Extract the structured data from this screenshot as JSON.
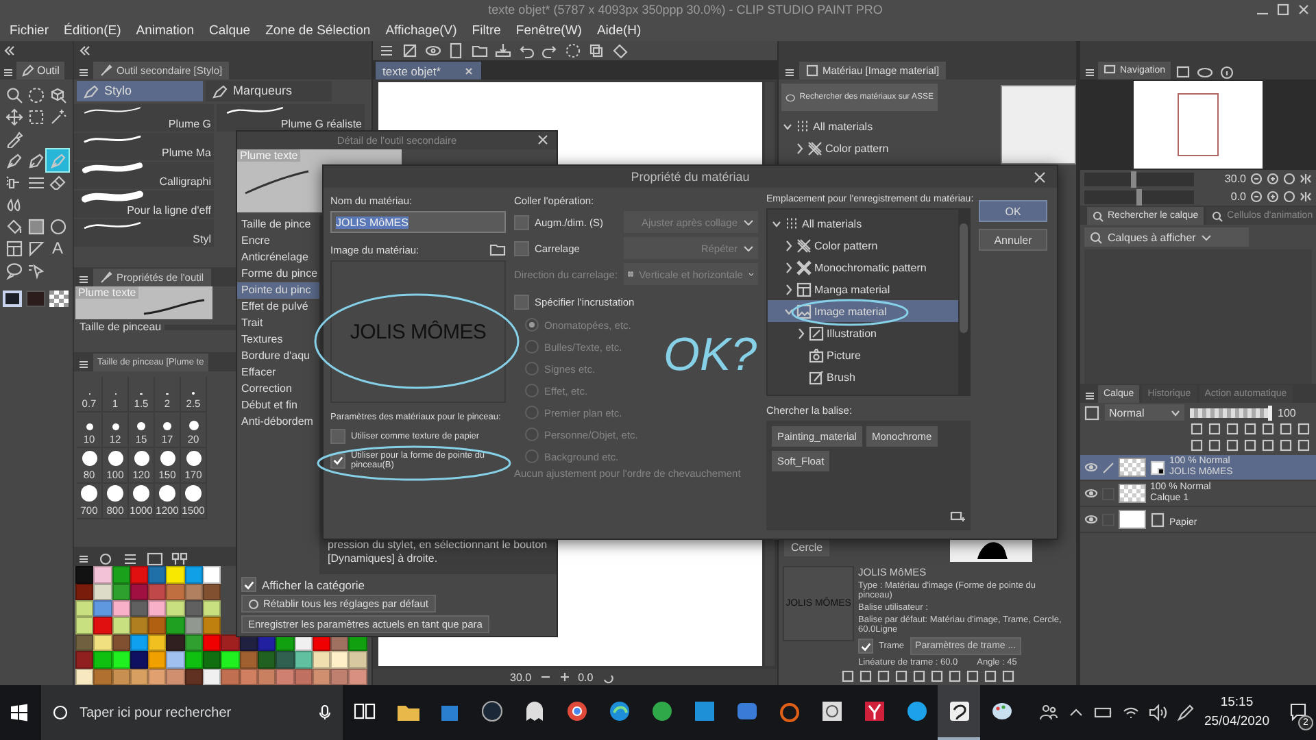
{
  "window": {
    "title": "texte objet* (5787 x 4093px 350ppp 30.0%) - CLIP STUDIO PAINT PRO"
  },
  "menu": [
    "Fichier",
    "Édition(E)",
    "Animation",
    "Calque",
    "Zone de Sélection",
    "Affichage(V)",
    "Filtre",
    "Fenêtre(W)",
    "Aide(H)"
  ],
  "tool_panel": {
    "tab": "Outil",
    "tools": [
      {
        "selected": false
      },
      {
        "selected": false
      },
      {
        "selected": false
      },
      {
        "selected": false
      },
      {
        "selected": false
      },
      {
        "selected": false
      },
      {
        "selected": false
      },
      {
        "selected": false
      },
      {
        "selected": false
      },
      {
        "selected": true
      },
      {
        "selected": false
      },
      {
        "selected": false
      },
      {
        "selected": false
      },
      {
        "selected": false
      },
      {
        "selected": false
      },
      {
        "selected": false
      },
      {
        "selected": false
      },
      {
        "selected": false
      },
      {
        "selected": false
      },
      {
        "selected": false,
        "label": "A"
      },
      {
        "selected": false
      },
      {
        "selected": false
      }
    ],
    "color_swatches": [
      {
        "color": "#1c2026",
        "selected": true
      },
      {
        "color": "#2c1c1c",
        "selected": false
      }
    ]
  },
  "subtool_panel": {
    "title": "Outil secondaire [Stylo]",
    "groups": [
      {
        "label": "Stylo",
        "selected": true
      },
      {
        "label": "Marqueurs",
        "selected": false
      }
    ],
    "brushes": [
      {
        "label": "Plume G",
        "selected": false
      },
      {
        "label": "Plume G réaliste",
        "selected": false
      },
      {
        "label": "Plume Ma",
        "selected": false
      },
      {
        "label": "Calligraphi",
        "selected": false
      },
      {
        "label": "Pour la ligne d'eff",
        "selected": false
      },
      {
        "label": "Styl",
        "selected": false
      }
    ]
  },
  "tool_properties": {
    "title": "Propriétés de l'outil",
    "preview_label": "Plume texte",
    "setting": "Taille de pinceau"
  },
  "brush_size": {
    "title": "Taille de pinceau [Plume te",
    "sizes": [
      "0.7",
      "1",
      "1.5",
      "2",
      "2.5",
      "10",
      "12",
      "15",
      "17",
      "20",
      "80",
      "100",
      "120",
      "150",
      "170",
      "700",
      "800",
      "1000",
      "1200",
      "1500"
    ]
  },
  "color_set": {
    "swatches": [
      {
        "color": "#121212"
      },
      {
        "color": "#f4c2d7"
      },
      {
        "color": "#1aa01a"
      },
      {
        "color": "#e01010"
      },
      {
        "color": "#1f6fa8"
      },
      {
        "color": "#f8e800"
      },
      {
        "color": "#10a0e8"
      },
      {
        "color": "#ffffff"
      },
      {
        "color": "#7a1c0c"
      },
      {
        "color": "#dcdcc8"
      },
      {
        "color": "#2ea02e"
      },
      {
        "color": "#a01040"
      },
      {
        "color": "#c04848"
      },
      {
        "color": "#c07040"
      },
      {
        "color": "#b08060"
      },
      {
        "color": "#805030"
      },
      {
        "color": "#c8e080"
      },
      {
        "color": "#6098e0"
      },
      {
        "color": "#f8b0c8"
      },
      {
        "color": "#606060"
      },
      {
        "color": "#f8b0c8"
      },
      {
        "color": "#c8e080"
      },
      {
        "color": "#606060"
      },
      {
        "color": "#c8e080"
      },
      {
        "color": "#c8e080"
      },
      {
        "color": "#e01010"
      },
      {
        "color": "#c8e080"
      },
      {
        "color": "#b08020"
      },
      {
        "color": "#b06010"
      },
      {
        "color": "#20a020"
      },
      {
        "color": "#909890"
      },
      {
        "color": "#c08010"
      },
      {
        "color": "#706040"
      },
      {
        "color": "#f0e080"
      },
      {
        "color": "#805030"
      },
      {
        "color": "#10a0f0"
      },
      {
        "color": "#f0c020"
      },
      {
        "color": "#302020"
      },
      {
        "color": "#30a030"
      },
      {
        "color": "#f00000"
      },
      {
        "color": "#a02020"
      },
      {
        "color": "#202040"
      },
      {
        "color": "#2020a0"
      },
      {
        "color": "#10a010"
      },
      {
        "color": "#f0f0f0"
      },
      {
        "color": "#f00000"
      },
      {
        "color": "#a07060"
      },
      {
        "color": "#10a010"
      },
      {
        "color": "#902020"
      },
      {
        "color": "#10c010"
      },
      {
        "color": "#20f020"
      },
      {
        "color": "#101060"
      },
      {
        "color": "#f0a000"
      },
      {
        "color": "#a0c0f0"
      },
      {
        "color": "#10c010"
      },
      {
        "color": "#107010"
      },
      {
        "color": "#20f020"
      },
      {
        "color": "#a06030"
      },
      {
        "color": "#206020"
      },
      {
        "color": "#306050"
      },
      {
        "color": "#60c0a0"
      },
      {
        "color": "#f0e0b0"
      },
      {
        "color": "#fff0c8"
      },
      {
        "color": "#d8c8a0"
      },
      {
        "color": "#f8e8c0"
      },
      {
        "color": "#b07030"
      },
      {
        "color": "#c89050"
      },
      {
        "color": "#d8a060"
      },
      {
        "color": "#e0a070"
      },
      {
        "color": "#d09070"
      },
      {
        "color": "#603020"
      },
      {
        "color": "#f0f0f0"
      },
      {
        "color": "#c07050"
      },
      {
        "color": "#d08060"
      },
      {
        "color": "#c88060"
      },
      {
        "color": "#d08070"
      },
      {
        "color": "#c07060"
      },
      {
        "color": "#d09070"
      },
      {
        "color": "#c08070"
      },
      {
        "color": "#d89080"
      }
    ]
  },
  "canvas": {
    "tab": "texte objet*",
    "zoom": "30.0",
    "angle": "0.0"
  },
  "material_panel": {
    "title": "Matériau [Image material]",
    "search_button": "Rechercher des matériaux sur ASSE",
    "tree": [
      {
        "label": "All materials",
        "expanded": true,
        "selected": false,
        "children": [
          {
            "label": "Color pattern",
            "expanded": false,
            "selected": false
          }
        ]
      }
    ],
    "tag": "Cercle",
    "detail": {
      "preview_text": "JOLIS MÔMES",
      "name": "JOLIS MôMES",
      "type": "Type : Matériau d'image (Forme de pointe du pinceau)",
      "user_tag": "Balise utilisateur :",
      "default_tag": "Balise par défaut: Matériau d'image, Trame, Cercle, 60.0Ligne",
      "screen": {
        "label": "Trame",
        "checked": true
      },
      "screen_button": "Paramètres de trame ...",
      "lineature": "Linéature de trame : 60.0",
      "angle": "Angle : 45"
    }
  },
  "navigator": {
    "tab": "Navigation",
    "sliders": [
      {
        "level": 0.45,
        "reading": "30.0"
      },
      {
        "level": 0.5,
        "reading": "0.0"
      }
    ]
  },
  "layer_search": {
    "tabs": [
      {
        "label": "Rechercher le calque",
        "selected": true
      },
      {
        "label": "Cellulos d'animation",
        "selected": false
      }
    ],
    "filter": "Calques à afficher"
  },
  "layers_panel": {
    "tabs": [
      {
        "label": "Calque",
        "selected": true
      },
      {
        "label": "Historique",
        "selected": false
      },
      {
        "label": "Action automatique",
        "selected": false
      }
    ],
    "blend_mode": "Normal",
    "opacity": {
      "level": 1,
      "reading": "100"
    },
    "layers": [
      {
        "kind": "material",
        "mode": "100 % Normal",
        "name": "JOLIS MôMES",
        "selected": true,
        "visible": true
      },
      {
        "kind": "raster",
        "mode": "100 % Normal",
        "name": "Calque 1",
        "selected": false,
        "visible": true
      },
      {
        "kind": "paper",
        "name": "Papier",
        "selected": false,
        "visible": true
      }
    ]
  },
  "detail_dialog": {
    "title": "Détail de l'outil secondaire",
    "preview_label": "Plume texte",
    "categories": [
      {
        "label": "Taille de pince",
        "selected": false
      },
      {
        "label": "Encre",
        "selected": false
      },
      {
        "label": "Anticrénelage",
        "selected": false
      },
      {
        "label": "Forme du pince",
        "selected": false
      },
      {
        "label": "Pointe du pinc",
        "selected": true
      },
      {
        "label": "Effet de pulvé",
        "selected": false
      },
      {
        "label": "Trait",
        "selected": false
      },
      {
        "label": "Textures",
        "selected": false
      },
      {
        "label": "Bordure d'aqu",
        "selected": false
      },
      {
        "label": "Effacer",
        "selected": false
      },
      {
        "label": "Correction",
        "selected": false
      },
      {
        "label": "Début et fin",
        "selected": false
      },
      {
        "label": "Anti-débordem",
        "selected": false
      }
    ],
    "description": "pression du stylet, en sélectionnant le bouton [Dynamiques] à droite.",
    "show_category": {
      "label": "Afficher la catégorie",
      "checked": true
    },
    "buttons": [
      "Rétablir tous les réglages par défaut",
      "Enregistrer les paramètres actuels en tant que para"
    ]
  },
  "material_dialog": {
    "title": "Propriété du matériau",
    "name_label": "Nom du matériau:",
    "name_value": "JOLIS MôMES",
    "image_label": "Image du matériau:",
    "image_text": "JOLIS MÔMES",
    "brush_settings_label": "Paramètres des matériaux pour le pinceau:",
    "brush_options": [
      {
        "label": "Utiliser comme texture de papier",
        "checked": false
      },
      {
        "label": "Utiliser pour la forme de pointe du pinceau(B)",
        "checked": true
      }
    ],
    "paste_label": "Coller l'opération:",
    "paste_options": [
      {
        "label": "Augm./dim. (S)",
        "checked": false,
        "dropdown": {
          "value": "Ajuster après collage",
          "disabled": true
        }
      },
      {
        "label": "Carrelage",
        "checked": false,
        "dropdown": {
          "value": "Répéter",
          "disabled": true
        }
      }
    ],
    "tiling_direction": {
      "label": "Direction du carrelage:",
      "value": "Verticale et horizontale",
      "disabled": true
    },
    "overlay": {
      "label": "Spécifier l'incrustation",
      "checked": false
    },
    "layer_orders": [
      {
        "label": "Onomatopées, etc.",
        "selected": true,
        "disabled": true
      },
      {
        "label": "Bulles/Texte, etc.",
        "selected": false,
        "disabled": true
      },
      {
        "label": "Signes etc.",
        "selected": false,
        "disabled": true
      },
      {
        "label": "Effet, etc.",
        "selected": false,
        "disabled": true
      },
      {
        "label": "Premier plan etc.",
        "selected": false,
        "disabled": true
      },
      {
        "label": "Personne/Objet, etc.",
        "selected": false,
        "disabled": true
      },
      {
        "label": "Background etc.",
        "selected": false,
        "disabled": true
      }
    ],
    "order_note": "Aucun ajustement pour l'ordre de chevauchement",
    "location_label": "Emplacement pour l'enregistrement du matériau:",
    "tree": [
      {
        "label": "All materials",
        "expanded": true,
        "selected": false,
        "children": [
          {
            "label": "Color pattern",
            "expanded": false,
            "selected": false
          },
          {
            "label": "Monochromatic pattern",
            "expanded": false,
            "selected": false
          },
          {
            "label": "Manga material",
            "expanded": false,
            "selected": false
          },
          {
            "label": "Image material",
            "expanded": true,
            "selected": true,
            "children": [
              {
                "label": "Illustration",
                "expanded": false,
                "selected": false
              },
              {
                "label": "Picture",
                "selected": false
              },
              {
                "label": "Brush",
                "selected": false
              }
            ]
          }
        ]
      }
    ],
    "tag_search_label": "Chercher la balise:",
    "tags": [
      "Painting_material",
      "Monochrome",
      "Soft_Float"
    ],
    "buttons": [
      {
        "label": "OK",
        "default": true
      },
      {
        "label": "Annuler",
        "default": false
      }
    ],
    "handwritten_note": "OK?"
  },
  "taskbar": {
    "search_placeholder": "Taper ici pour rechercher",
    "apps": [
      {
        "selected": false
      },
      {
        "selected": false
      },
      {
        "selected": false
      },
      {
        "selected": false
      },
      {
        "selected": false
      },
      {
        "selected": false
      },
      {
        "selected": false
      },
      {
        "selected": false
      },
      {
        "selected": false
      },
      {
        "selected": false
      },
      {
        "selected": false
      },
      {
        "selected": false
      },
      {
        "selected": false
      },
      {
        "selected": true
      },
      {
        "selected": false
      }
    ],
    "time": "15:15",
    "date": "25/04/2020",
    "notifications": "2"
  }
}
